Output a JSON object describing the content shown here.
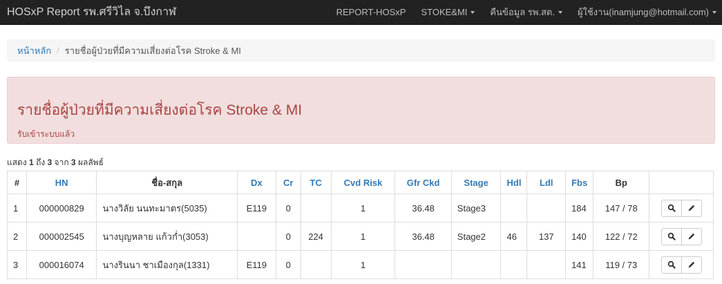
{
  "navbar": {
    "brand": "HOSxP Report รพ.ศรีวิไล จ.บึงกาฬ",
    "items": [
      {
        "label": "REPORT-HOSxP",
        "dropdown": false
      },
      {
        "label": "STOKE&MI",
        "dropdown": true
      },
      {
        "label": "คืนข้อมูล รพ.สต.",
        "dropdown": true
      },
      {
        "label": "ผู้ใช้งาน(inamjung@hotmail.com)",
        "dropdown": true
      }
    ]
  },
  "breadcrumb": {
    "home": "หน้าหลัก",
    "separator": "/",
    "current": "รายชื่อผู้ป่วยที่มีความเสี่ยงต่อโรค Stroke & MI"
  },
  "alert": {
    "title": "รายชื่อผู้ป่วยที่มีความเสี่ยงต่อโรค Stroke & MI",
    "subtitle": "รับเข้าระบบแล้ว"
  },
  "summary": {
    "prefix": "แสดง ",
    "from": "1",
    "mid": " ถึง ",
    "to": "3",
    "mid2": " จาก ",
    "total": "3",
    "suffix": " ผลลัพธ์"
  },
  "table": {
    "headers": [
      {
        "label": "#",
        "sortable": false
      },
      {
        "label": "HN",
        "sortable": true
      },
      {
        "label": "ชื่อ-สกุล",
        "sortable": false
      },
      {
        "label": "Dx",
        "sortable": true
      },
      {
        "label": "Cr",
        "sortable": true
      },
      {
        "label": "TC",
        "sortable": true
      },
      {
        "label": "Cvd Risk",
        "sortable": true
      },
      {
        "label": "Gfr Ckd",
        "sortable": true
      },
      {
        "label": "Stage",
        "sortable": true
      },
      {
        "label": "Hdl",
        "sortable": true
      },
      {
        "label": "Ldl",
        "sortable": true
      },
      {
        "label": "Fbs",
        "sortable": true
      },
      {
        "label": "Bp",
        "sortable": false
      },
      {
        "label": "",
        "sortable": false
      }
    ],
    "rows": [
      [
        "1",
        "000000829",
        "นางวิลัย นนทะมาตร(5035)",
        "E119",
        "0",
        "",
        "1",
        "36.48",
        "Stage3",
        "",
        "",
        "184",
        "147 / 78"
      ],
      [
        "2",
        "000002545",
        "นางบุญหลาย แก้วก่ำ(3053)",
        "",
        "0",
        "224",
        "1",
        "36.48",
        "Stage2",
        "46",
        "137",
        "140",
        "122 / 72"
      ],
      [
        "3",
        "000016074",
        "นางรินนา ชาเมืองกุล(1331)",
        "E119",
        "0",
        "",
        "1",
        "",
        "",
        "",
        "",
        "141",
        "119 / 73"
      ]
    ],
    "action_icons": [
      "search-icon",
      "pencil-icon"
    ]
  },
  "colors": {
    "navbar_bg": "#222222",
    "link": "#337ab7",
    "alert_bg": "#f2dede",
    "alert_text": "#a94442"
  }
}
